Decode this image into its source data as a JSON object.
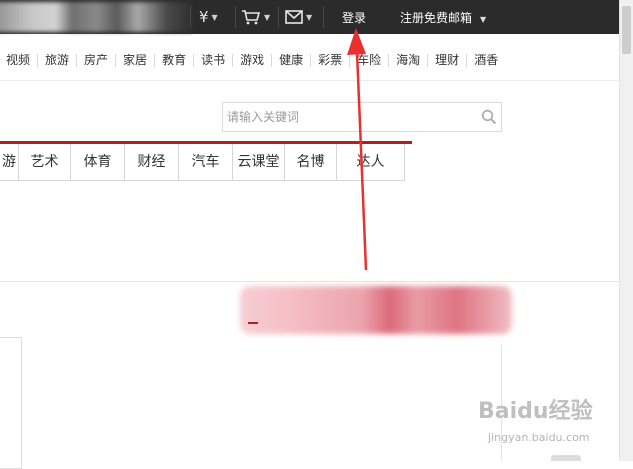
{
  "topbar": {
    "icons": [
      {
        "name": "yen-icon",
        "glyph": "¥"
      },
      {
        "name": "cart-icon",
        "glyph": "🛒"
      },
      {
        "name": "mail-icon",
        "glyph": "✉"
      }
    ],
    "caret": "▼",
    "login_label": "登录",
    "register_label": "注册免费邮箱"
  },
  "channel_nav": [
    "视频",
    "旅游",
    "房产",
    "家居",
    "教育",
    "读书",
    "游戏",
    "健康",
    "彩票",
    "车险",
    "海淘",
    "理财",
    "酒香"
  ],
  "search": {
    "placeholder": "请输入关键词",
    "icon": "search-icon"
  },
  "category_tabs": [
    "游",
    "艺术",
    "体育",
    "财经",
    "汽车",
    "云课堂",
    "名博",
    "达人"
  ],
  "colors": {
    "topbar_bg": "#2b2b2b",
    "accent_red": "#b71c1c",
    "annotation_arrow": "#e8302f"
  },
  "watermark": {
    "brand": "Baidu经验",
    "url": "jingyan.baidu.com"
  }
}
